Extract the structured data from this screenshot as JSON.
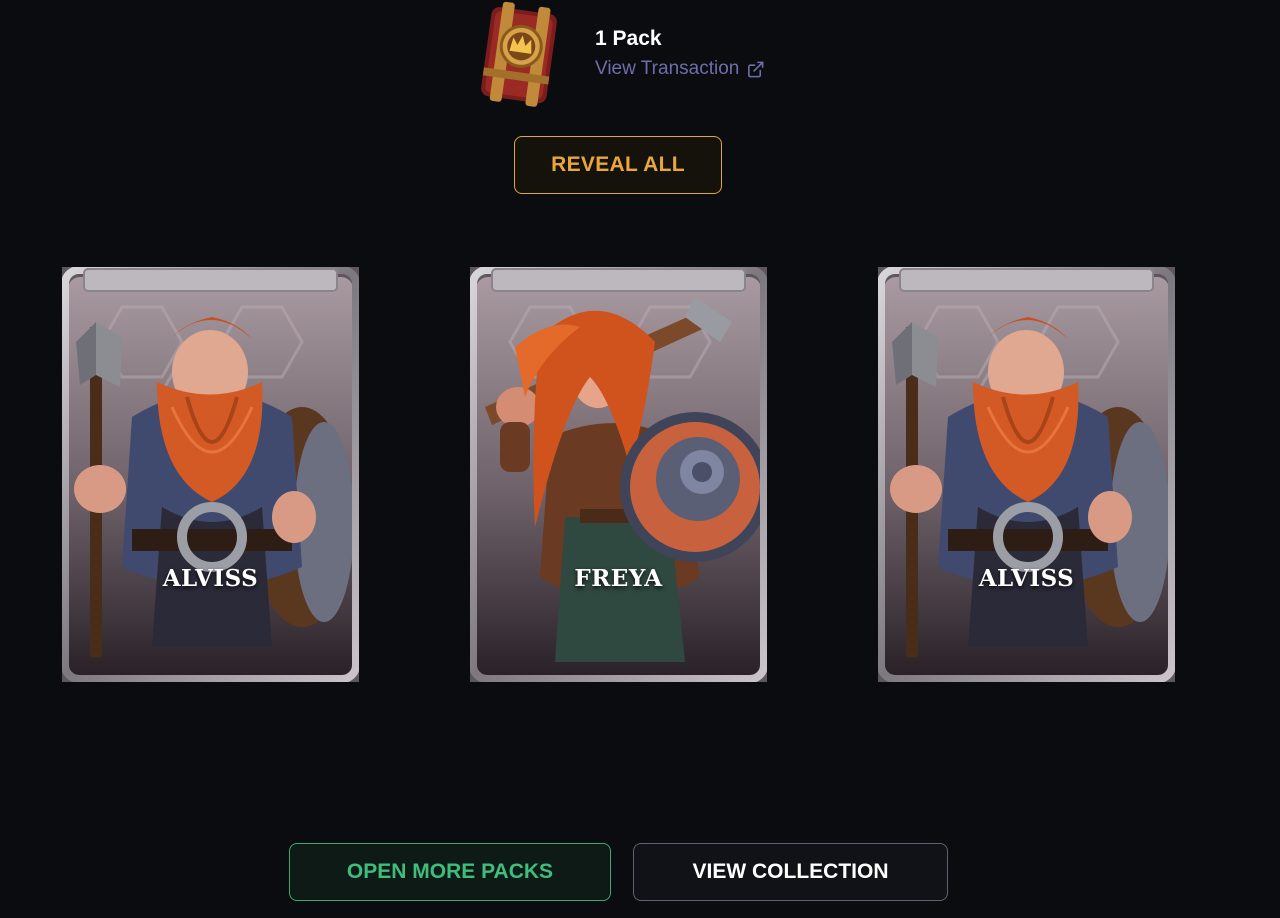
{
  "pack": {
    "title": "1 Pack",
    "view_transaction": "View Transaction",
    "icon": "backpack-crown-icon"
  },
  "actions": {
    "reveal_all": "REVEAL ALL",
    "open_more": "OPEN MORE PACKS",
    "view_collection": "VIEW COLLECTION"
  },
  "cards": [
    {
      "name": "ALVISS",
      "character": "dwarf-warrior"
    },
    {
      "name": "FREYA",
      "character": "shieldmaiden"
    },
    {
      "name": "ALVISS",
      "character": "dwarf-warrior"
    }
  ],
  "colors": {
    "background": "#0a0c10",
    "reveal_accent": "#e9a73b",
    "open_accent": "#3fbd7c",
    "link": "#6e6ea8"
  }
}
